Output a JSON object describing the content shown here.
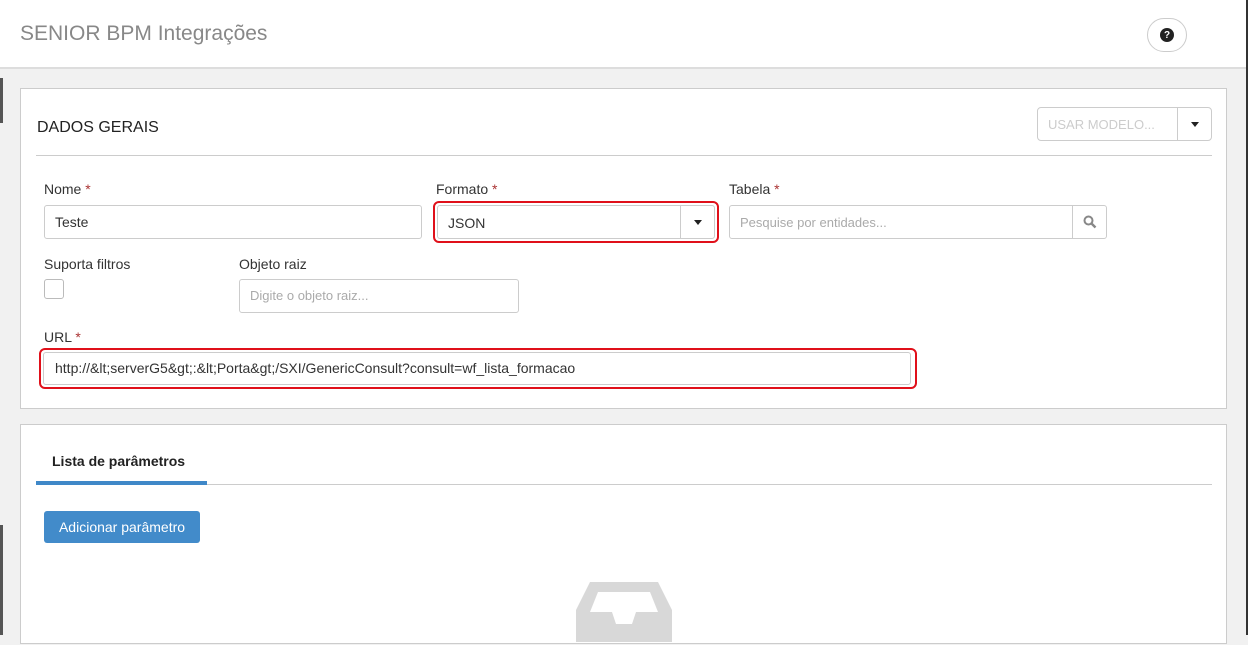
{
  "header": {
    "title": "SENIOR BPM Integrações",
    "help_icon": "question-circle-icon"
  },
  "general": {
    "section_title": "DADOS GERAIS",
    "use_model": {
      "placeholder": "USAR MODELO..."
    },
    "nome": {
      "label": "Nome",
      "required": "*",
      "value": "Teste"
    },
    "formato": {
      "label": "Formato",
      "required": "*",
      "value": "JSON"
    },
    "tabela": {
      "label": "Tabela",
      "required": "*",
      "placeholder": "Pesquise por entidades..."
    },
    "suporta_filtros": {
      "label": "Suporta filtros",
      "checked": false
    },
    "objeto_raiz": {
      "label": "Objeto raiz",
      "placeholder": "Digite o objeto raiz..."
    },
    "url": {
      "label": "URL",
      "required": "*",
      "value": "http://&lt;serverG5&gt;:&lt;Porta&gt;/SXI/GenericConsult?consult=wf_lista_formacao"
    }
  },
  "params": {
    "tab_label": "Lista de parâmetros",
    "add_button": "Adicionar parâmetro",
    "empty_icon": "inbox-icon"
  },
  "colors": {
    "accent": "#428bca",
    "highlight": "#e0101a"
  }
}
